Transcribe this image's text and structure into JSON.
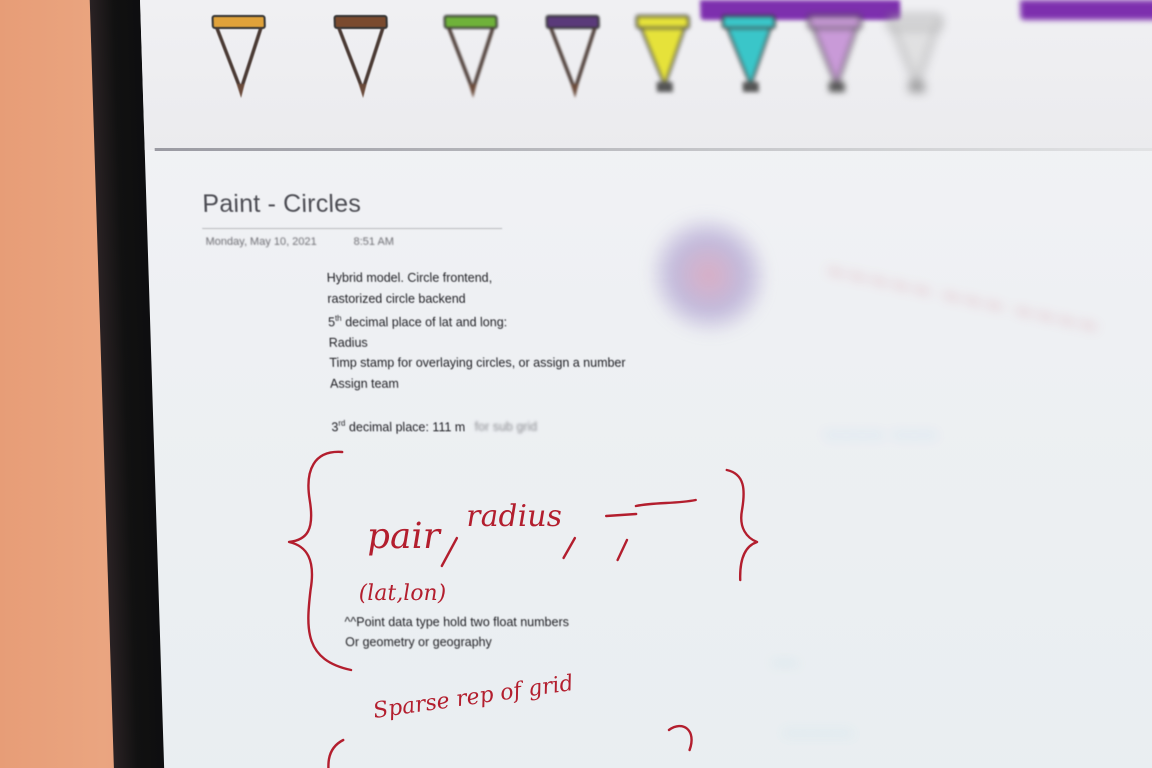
{
  "colors": {
    "wall": "#e9a27c",
    "bezel": "#111111",
    "screen": "#eef0f3",
    "ribbon_purple": "#7d2fae",
    "ink_red": "#b31e2e"
  },
  "toolbar": {
    "pens": [
      {
        "name": "orange-pen-icon",
        "color": "#e0a23a"
      },
      {
        "name": "brown-pen-icon",
        "color": "#7a4a2e"
      },
      {
        "name": "green-pen-icon",
        "color": "#6fb23a"
      },
      {
        "name": "purple-pen-icon",
        "color": "#5a3a7a"
      },
      {
        "name": "yellow-highlighter-icon",
        "color": "#e6e23a"
      },
      {
        "name": "cyan-highlighter-icon",
        "color": "#3ac6c9"
      },
      {
        "name": "lilac-highlighter-icon",
        "color": "#c99ad8"
      },
      {
        "name": "eraser-icon",
        "color": "#d8d8d8"
      }
    ]
  },
  "page": {
    "title": "Paint - Circles",
    "date": "Monday, May 10, 2021",
    "time": "8:51 AM"
  },
  "notes": {
    "line1": "Hybrid model. Circle frontend,",
    "line2": "rastorized circle backend",
    "line3_prefix": "5",
    "line3_sup": "th",
    "line3_text": " decimal place of lat and long:",
    "line4": "Radius",
    "line5": "Timp stamp for overlaying circles, or assign a number",
    "line6": "Assign team",
    "line7_prefix": "3",
    "line7_sup": "rd",
    "line7_text": " decimal place: 111 m",
    "line7_suffix": "for sub grid"
  },
  "handwriting": {
    "word1": "pair",
    "word2": "radius",
    "word3": "(lat,lon)",
    "word4": "Sparse rep of grid"
  },
  "sub_notes": {
    "line1": "^^Point data type hold two float numbers",
    "line2": "Or geometry or geography"
  }
}
